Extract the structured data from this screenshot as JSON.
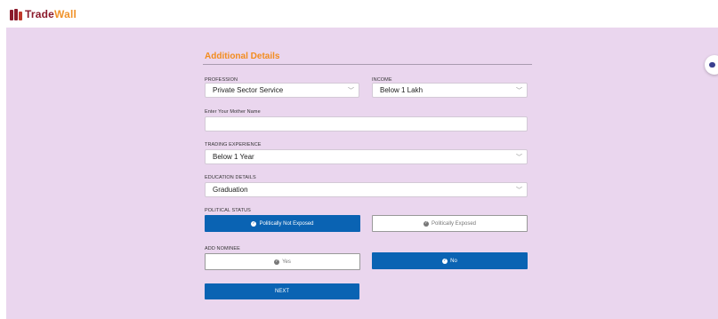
{
  "brand": {
    "name_part1": "Trade",
    "name_part2": "Wall"
  },
  "form": {
    "title": "Additional Details",
    "profession": {
      "label": "PROFESSION",
      "value": "Private Sector Service"
    },
    "income": {
      "label": "INCOME",
      "value": "Below 1 Lakh"
    },
    "mother_name": {
      "label": "Enter Your Mother Name",
      "value": ""
    },
    "trading_experience": {
      "label": "TRADING EXPERIENCE",
      "value": "Below 1 Year"
    },
    "education": {
      "label": "EDUCATION DETAILS",
      "value": "Graduation"
    },
    "political_status": {
      "label": "POLITICAL STATUS",
      "options": [
        "Politically Not Exposed",
        "Politically Exposed"
      ],
      "selected": "Politically Not Exposed"
    },
    "nominee": {
      "label": "ADD NOMINEE",
      "options": [
        "Yes",
        "No"
      ],
      "selected": "No"
    },
    "next_label": "NEXT"
  },
  "colors": {
    "accent": "#0a63b3",
    "title": "#f28c1e",
    "background": "#ead6ee"
  },
  "icons": {
    "dropdown": "chevron-down-icon",
    "check": "check-circle-icon"
  }
}
